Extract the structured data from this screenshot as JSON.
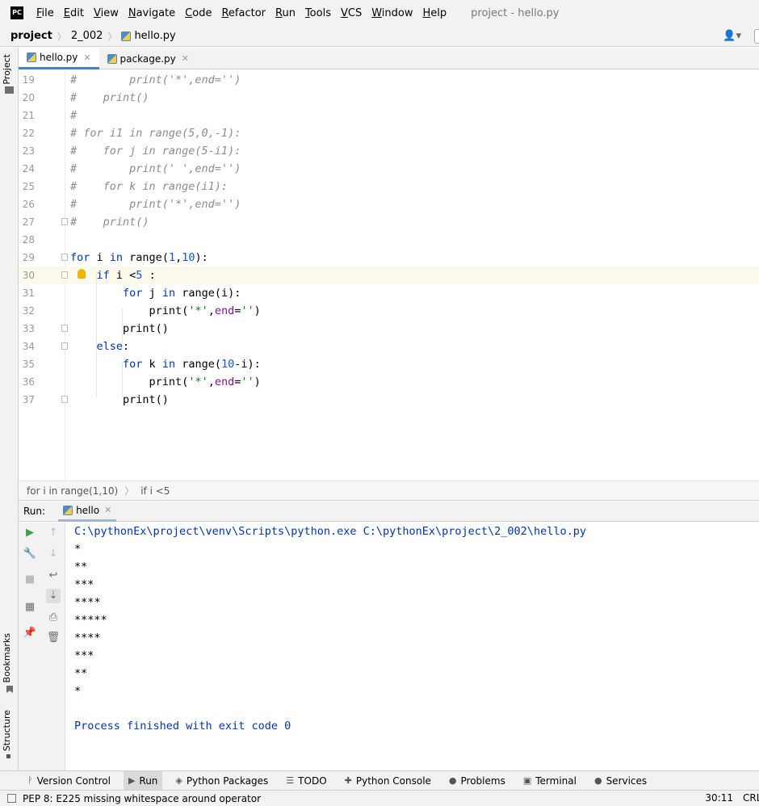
{
  "menubar": {
    "logo": "PC",
    "items": [
      {
        "mn": "F",
        "rest": "ile"
      },
      {
        "mn": "E",
        "rest": "dit"
      },
      {
        "mn": "V",
        "rest": "iew"
      },
      {
        "mn": "N",
        "rest": "avigate"
      },
      {
        "mn": "C",
        "rest": "ode"
      },
      {
        "mn": "R",
        "rest": "efactor"
      },
      {
        "mn": "R",
        "rest": "un"
      },
      {
        "mn": "T",
        "rest": "ools"
      },
      {
        "mn": "V",
        "rest": "CS"
      },
      {
        "mn": "W",
        "rest": "indow"
      },
      {
        "mn": "H",
        "rest": "elp"
      }
    ],
    "window_title": "project - hello.py"
  },
  "navbar": {
    "project": "project",
    "folder": "2_002",
    "file": "hello.py"
  },
  "left_strip": {
    "project": "Project",
    "bookmarks": "Bookmarks",
    "structure": "Structure"
  },
  "editor_tabs": [
    {
      "label": "hello.py",
      "active": true
    },
    {
      "label": "package.py",
      "active": false
    }
  ],
  "editor": {
    "current_line": 30,
    "lines": [
      {
        "n": "19",
        "tokens": [
          [
            "cm",
            "#        print('*',end='')"
          ]
        ]
      },
      {
        "n": "20",
        "tokens": [
          [
            "cm",
            "#    print()"
          ]
        ]
      },
      {
        "n": "21",
        "tokens": [
          [
            "cm",
            "#"
          ]
        ]
      },
      {
        "n": "22",
        "tokens": [
          [
            "cm",
            "# for i1 in range(5,0,-1):"
          ]
        ]
      },
      {
        "n": "23",
        "tokens": [
          [
            "cm",
            "#    for j in range(5-i1):"
          ]
        ]
      },
      {
        "n": "24",
        "tokens": [
          [
            "cm",
            "#        print(' ',end='')"
          ]
        ]
      },
      {
        "n": "25",
        "tokens": [
          [
            "cm",
            "#    for k in range(i1):"
          ]
        ]
      },
      {
        "n": "26",
        "tokens": [
          [
            "cm",
            "#        print('*',end='')"
          ]
        ]
      },
      {
        "n": "27",
        "tokens": [
          [
            "cm",
            "#    print()"
          ]
        ]
      },
      {
        "n": "28",
        "tokens": []
      },
      {
        "n": "29",
        "tokens": [
          [
            "kw",
            "for"
          ],
          [
            "",
            " i "
          ],
          [
            "kw",
            "in"
          ],
          [
            "",
            " range("
          ],
          [
            "num",
            "1"
          ],
          [
            "",
            ","
          ],
          [
            "num",
            "10"
          ],
          [
            "",
            "):"
          ]
        ]
      },
      {
        "n": "30",
        "tokens": [
          [
            "",
            "    "
          ],
          [
            "kw",
            "if"
          ],
          [
            "",
            " i <"
          ],
          [
            "num",
            "5"
          ],
          [
            "",
            " :"
          ]
        ]
      },
      {
        "n": "31",
        "tokens": [
          [
            "",
            "        "
          ],
          [
            "kw",
            "for"
          ],
          [
            "",
            " j "
          ],
          [
            "kw",
            "in"
          ],
          [
            "",
            " range(i):"
          ]
        ]
      },
      {
        "n": "32",
        "tokens": [
          [
            "",
            "            print("
          ],
          [
            "str",
            "'*'"
          ],
          [
            "",
            ","
          ],
          [
            "kwarg",
            "end"
          ],
          [
            "",
            "="
          ],
          [
            "str",
            "''"
          ],
          [
            "",
            ")"
          ]
        ]
      },
      {
        "n": "33",
        "tokens": [
          [
            "",
            "        print()"
          ]
        ]
      },
      {
        "n": "34",
        "tokens": [
          [
            "",
            "    "
          ],
          [
            "kw",
            "else"
          ],
          [
            "",
            ":"
          ]
        ]
      },
      {
        "n": "35",
        "tokens": [
          [
            "",
            "        "
          ],
          [
            "kw",
            "for"
          ],
          [
            "",
            " k "
          ],
          [
            "kw",
            "in"
          ],
          [
            "",
            " range("
          ],
          [
            "num",
            "10"
          ],
          [
            "",
            "-i):"
          ]
        ]
      },
      {
        "n": "36",
        "tokens": [
          [
            "",
            "            print("
          ],
          [
            "str",
            "'*'"
          ],
          [
            "",
            ","
          ],
          [
            "kwarg",
            "end"
          ],
          [
            "",
            "="
          ],
          [
            "str",
            "''"
          ],
          [
            "",
            ")"
          ]
        ]
      },
      {
        "n": "37",
        "tokens": [
          [
            "",
            "        print()"
          ]
        ]
      }
    ]
  },
  "breadcrumbs": [
    "for i in range(1,10)",
    "if i <5"
  ],
  "run": {
    "label": "Run:",
    "tab": "hello"
  },
  "console": {
    "command": "C:\\pythonEx\\project\\venv\\Scripts\\python.exe C:\\pythonEx\\project\\2_002\\hello.py",
    "output": [
      "*",
      "**",
      "***",
      "****",
      "*****",
      "****",
      "***",
      "**",
      "*"
    ],
    "exit": "Process finished with exit code 0"
  },
  "bottom_tabs": [
    {
      "label": "Version Control",
      "icon": "version-control-icon",
      "glyph": "ᚹ"
    },
    {
      "label": "Run",
      "icon": "run-icon",
      "glyph": "▶",
      "active": true
    },
    {
      "label": "Python Packages",
      "icon": "packages-icon",
      "glyph": "◈"
    },
    {
      "label": "TODO",
      "icon": "todo-icon",
      "glyph": "☰"
    },
    {
      "label": "Python Console",
      "icon": "python-console-icon",
      "glyph": "✚"
    },
    {
      "label": "Problems",
      "icon": "problems-icon",
      "glyph": "●"
    },
    {
      "label": "Terminal",
      "icon": "terminal-icon",
      "glyph": "▣"
    },
    {
      "label": "Services",
      "icon": "services-icon",
      "glyph": "●"
    }
  ],
  "statusbar": {
    "message": "PEP 8: E225 missing whitespace around operator",
    "position": "30:11",
    "line_sep": "CRLF"
  }
}
